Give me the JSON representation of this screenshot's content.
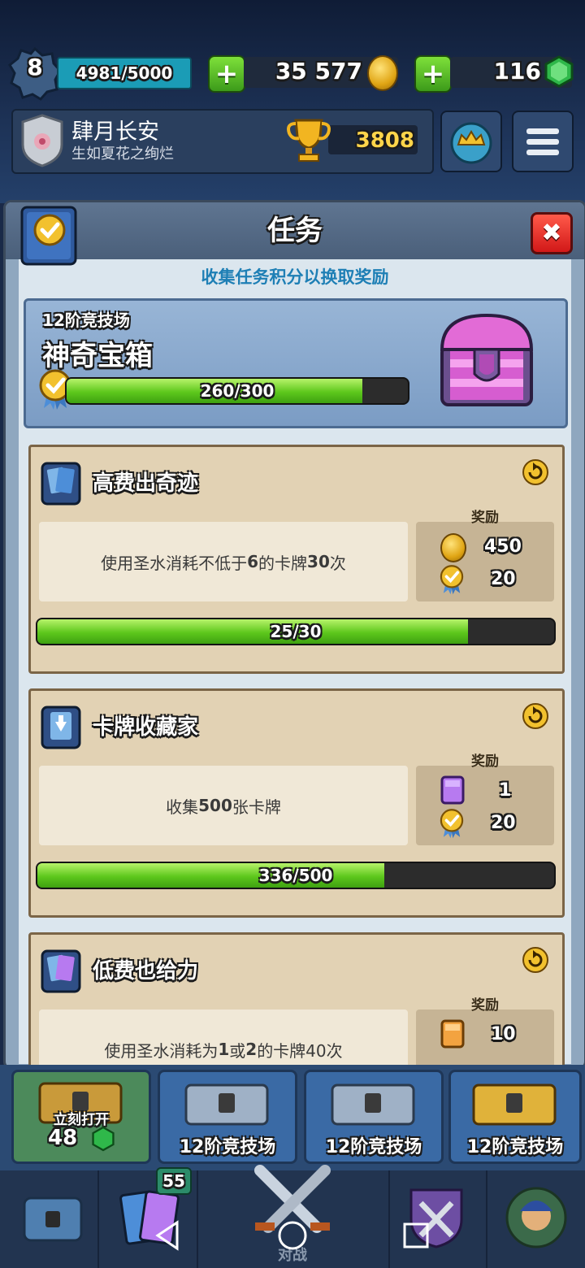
{
  "player": {
    "level": "8",
    "xp": "4981/5000",
    "name": "肆月长安",
    "motto": "生如夏花之绚烂",
    "trophies": "3808"
  },
  "resources": {
    "gold": "35 577",
    "gems": "116"
  },
  "modal": {
    "title": "任务",
    "subtitle": "收集任务积分以换取奖励"
  },
  "chest": {
    "arena": "12阶竞技场",
    "name": "神奇宝箱",
    "progress_text": "260/300",
    "progress": 0.867
  },
  "quests": [
    {
      "title": "高费出奇迹",
      "description_pre": "使用圣水消耗不低于",
      "description_num1": "6",
      "description_mid": "的卡牌",
      "description_num2": "30",
      "description_post": "次",
      "reward_label": "奖励",
      "reward1": "450",
      "reward2": "20",
      "progress_text": "25/30",
      "progress": 0.833
    },
    {
      "title": "卡牌收藏家",
      "description_pre": "收集",
      "description_num1": "500",
      "description_mid": "张卡牌",
      "description_num2": "",
      "description_post": "",
      "reward_label": "奖励",
      "reward1": "1",
      "reward2": "20",
      "progress_text": "336/500",
      "progress": 0.672
    },
    {
      "title": "低费也给力",
      "description_pre": "使用圣水消耗为",
      "description_num1": "1",
      "description_mid": "或",
      "description_num2": "2",
      "description_post": "的卡牌40次",
      "reward_label": "奖励",
      "reward1": "10",
      "reward2": "",
      "progress_text": "",
      "progress": 0
    }
  ],
  "chest_slots": [
    {
      "label": "立刻打开",
      "cost": "48"
    },
    {
      "label": "12阶竞技场"
    },
    {
      "label": "12阶竞技场"
    },
    {
      "label": "12阶竞技场"
    }
  ],
  "nav": {
    "cards_badge": "55",
    "battle_label": "对战"
  },
  "colors": {
    "progress_green": "#5dc71c",
    "close_red": "#d21818",
    "subtitle_blue": "#1e7fb5"
  }
}
